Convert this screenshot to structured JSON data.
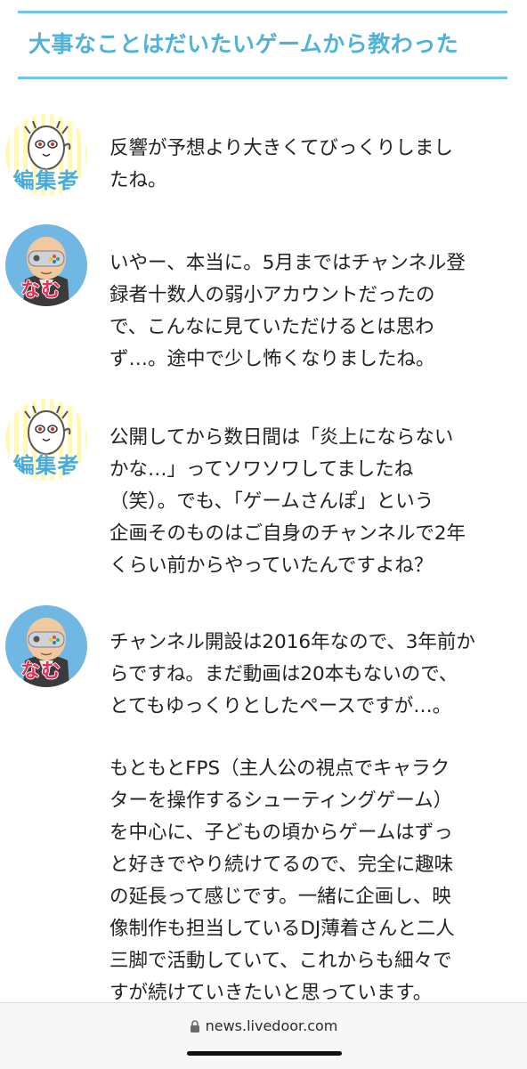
{
  "article": {
    "heading": "大事なことはだいたいゲームから教わった"
  },
  "speakers": {
    "editor": "編集者",
    "namu": "なむ"
  },
  "messages": [
    {
      "speaker": "editor",
      "lines": [
        "反響が予想より大きくてびっくりしまし",
        "たね。"
      ]
    },
    {
      "speaker": "namu",
      "lines": [
        "いやー、本当に。5月まではチャンネル登",
        "録者十数人の弱小アカウントだったの",
        "で、こんなに見ていただけるとは思わ",
        "ず…。途中で少し怖くなりましたね。"
      ]
    },
    {
      "speaker": "editor",
      "lines": [
        "公開してから数日間は「炎上にならない",
        "かな…」ってソワソワしてましたね",
        "（笑）。でも、「ゲームさんぽ」という",
        "企画そのものはご自身のチャンネルで2年",
        "くらい前からやっていたんですよね？"
      ]
    },
    {
      "speaker": "namu",
      "lines": [
        "チャンネル開設は2016年なので、3年前か",
        "らですね。まだ動画は20本もないので、",
        "とてもゆっくりとしたペースですが…。"
      ],
      "lines2": [
        "もともとFPS（主人公の視点でキャラク",
        "ターを操作するシューティングゲーム）",
        "を中心に、子どもの頃からゲームはずっ",
        "と好きでやり続けてるので、完全に趣味",
        "の延長って感じです。一緒に企画し、映",
        "像制作も担当しているDJ薄着さんと二人",
        "三脚で活動していて、これからも細々で",
        "すが続けていきたいと思っています。"
      ]
    }
  ],
  "browser": {
    "url": "news.livedoor.com",
    "lock_icon": "lock-icon"
  },
  "colors": {
    "accent": "#4fb3d9",
    "rule": "#6ec7e6",
    "namu_label": "#e0325a",
    "monk_bg": "#71b7e4"
  }
}
